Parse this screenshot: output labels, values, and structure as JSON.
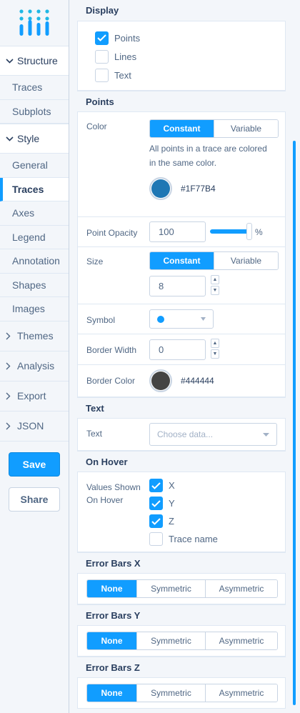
{
  "sidebar": {
    "groups": [
      {
        "label": "Structure",
        "items": [
          "Traces",
          "Subplots"
        ]
      },
      {
        "label": "Style",
        "items": [
          "General",
          "Traces",
          "Axes",
          "Legend",
          "Annotation",
          "Shapes",
          "Images"
        ]
      }
    ],
    "closed_groups": [
      "Themes",
      "Analysis",
      "Export",
      "JSON"
    ],
    "active_item": "Traces",
    "save_label": "Save",
    "share_label": "Share"
  },
  "panel": {
    "display": {
      "title": "Display",
      "options": [
        {
          "label": "Points",
          "checked": true
        },
        {
          "label": "Lines",
          "checked": false
        },
        {
          "label": "Text",
          "checked": false
        }
      ]
    },
    "points": {
      "title": "Points",
      "color": {
        "label": "Color",
        "mode_constant": "Constant",
        "mode_variable": "Variable",
        "description": "All points in a trace are colored in the same color.",
        "value": "#1F77B4",
        "swatch": "#1f77b4"
      },
      "opacity": {
        "label": "Point Opacity",
        "value": "100",
        "unit": "%",
        "level": 1.0
      },
      "size": {
        "label": "Size",
        "mode_constant": "Constant",
        "mode_variable": "Variable",
        "value": "8"
      },
      "symbol": {
        "label": "Symbol"
      },
      "border_width": {
        "label": "Border Width",
        "value": "0"
      },
      "border_color": {
        "label": "Border Color",
        "value": "#444444",
        "swatch": "#444444"
      }
    },
    "text": {
      "title": "Text",
      "label": "Text",
      "placeholder": "Choose data..."
    },
    "hover": {
      "title": "On Hover",
      "label": "Values Shown On Hover",
      "options": [
        {
          "label": "X",
          "checked": true
        },
        {
          "label": "Y",
          "checked": true
        },
        {
          "label": "Z",
          "checked": true
        },
        {
          "label": "Trace name",
          "checked": false
        }
      ]
    },
    "error_bars": [
      {
        "title": "Error Bars X",
        "options": [
          "None",
          "Symmetric",
          "Asymmetric"
        ],
        "selected": "None"
      },
      {
        "title": "Error Bars Y",
        "options": [
          "None",
          "Symmetric",
          "Asymmetric"
        ],
        "selected": "None"
      },
      {
        "title": "Error Bars Z",
        "options": [
          "None",
          "Symmetric",
          "Asymmetric"
        ],
        "selected": "None"
      }
    ]
  },
  "colors": {
    "accent": "#119dff",
    "text": "#2a3f5f",
    "muted": "#506784",
    "border": "#c8d4e3"
  }
}
